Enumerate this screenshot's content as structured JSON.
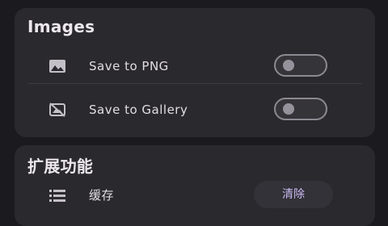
{
  "images_section": {
    "title": "Images",
    "rows": [
      {
        "label": "Save to PNG",
        "icon": "image-icon",
        "toggle_on": false
      },
      {
        "label": "Save to Gallery",
        "icon": "no-photo-icon",
        "toggle_on": false
      }
    ]
  },
  "extension_section": {
    "title": "扩展功能",
    "rows": [
      {
        "label": "缓存",
        "icon": "list-icon",
        "button_label": "清除"
      }
    ]
  },
  "colors": {
    "background": "#1b1a1e",
    "card": "#2a292d",
    "accent_text": "#c9b9f0",
    "toggle_outline": "#8d8992"
  }
}
